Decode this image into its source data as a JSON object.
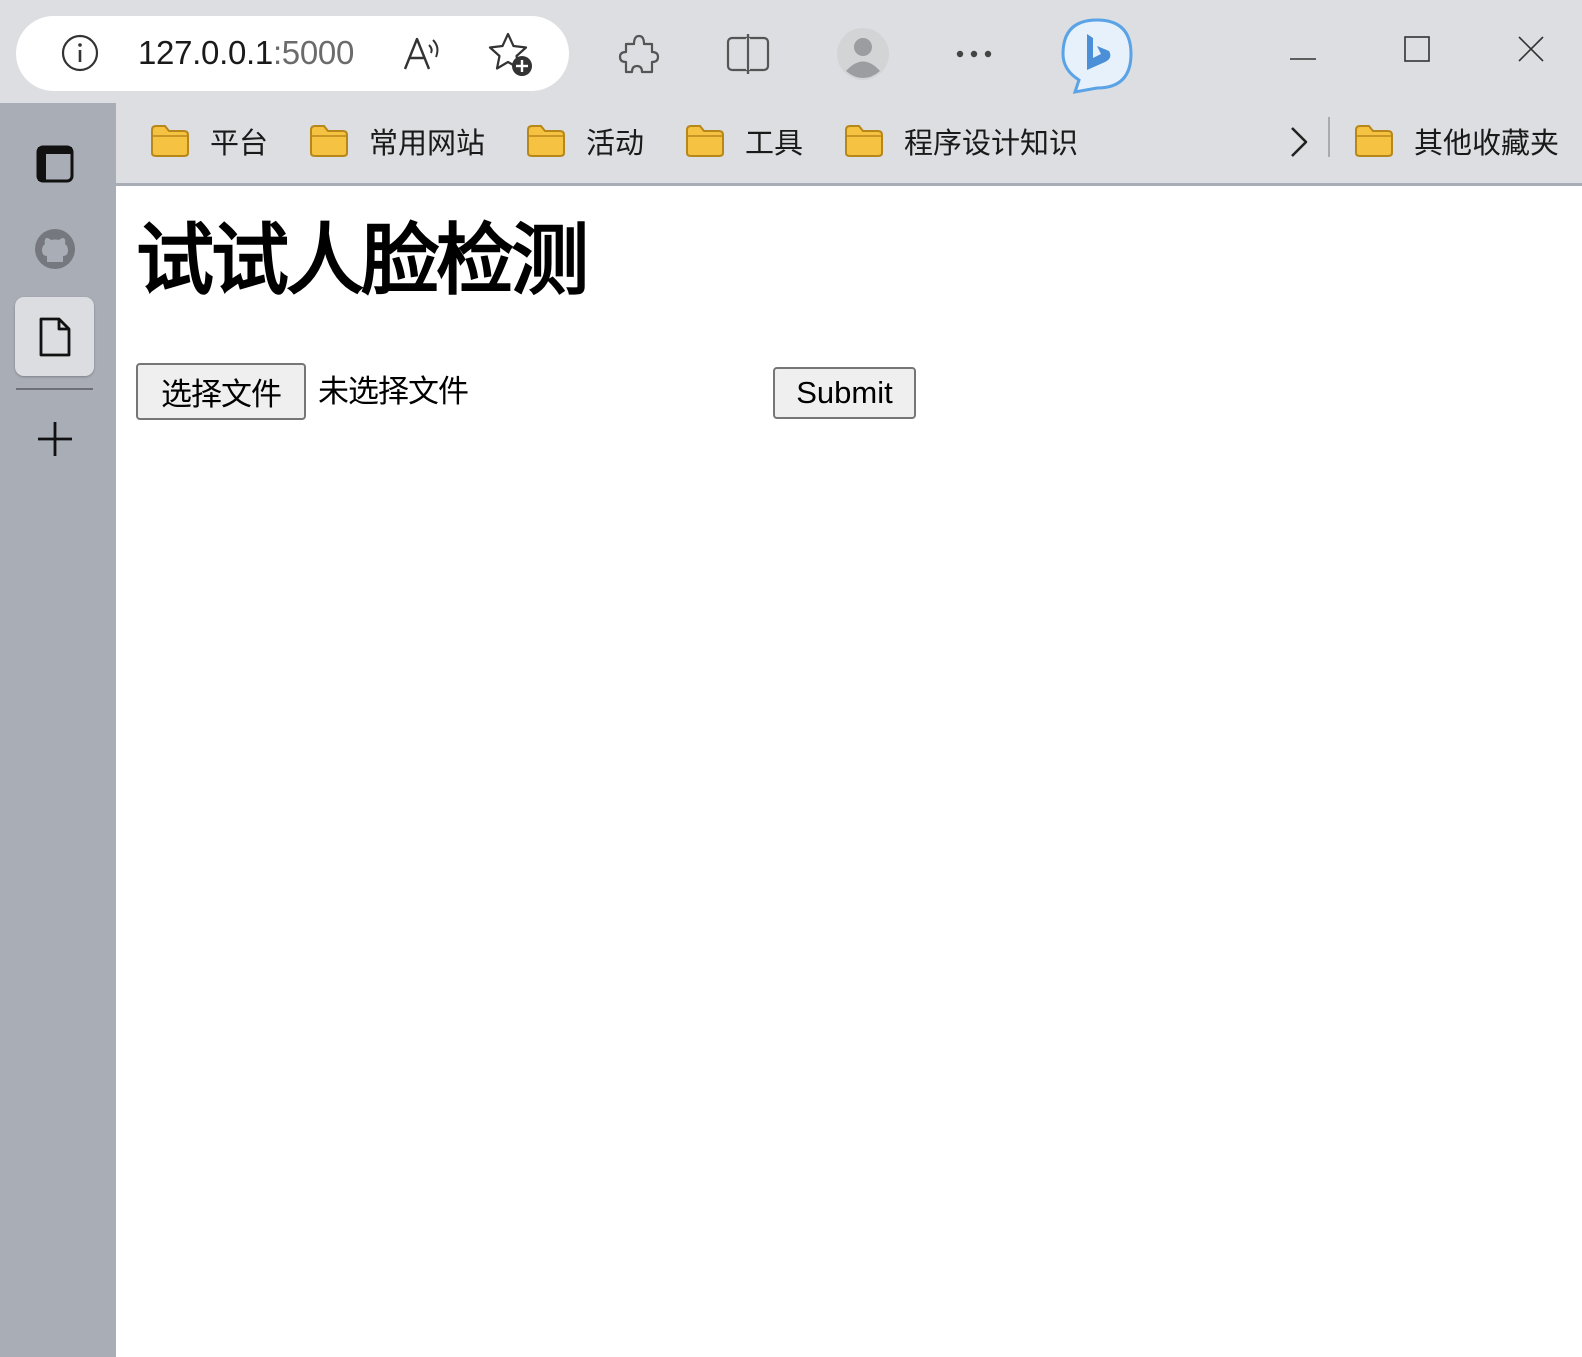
{
  "browser": {
    "address_bar": {
      "url_host": "127.0.0.1",
      "url_port": ":5000"
    },
    "icons": [
      "info-icon",
      "read-aloud-icon",
      "add-favorite-icon",
      "extensions-icon",
      "split-screen-icon",
      "profile-avatar",
      "more-icon",
      "bing-chat-icon",
      "minimize-icon",
      "maximize-icon",
      "close-icon"
    ]
  },
  "sidebar": {
    "items": [
      "tab-actions-icon",
      "github-icon",
      "document-icon",
      "add-icon"
    ]
  },
  "favorites_bar": {
    "items": [
      {
        "label": "平台"
      },
      {
        "label": "常用网站"
      },
      {
        "label": "活动"
      },
      {
        "label": "工具"
      },
      {
        "label": "程序设计知识"
      }
    ],
    "other_favorites": "其他收藏夹",
    "folder_color": "#f5c242"
  },
  "page": {
    "title": "试试人脸检测",
    "file_button_label": "选择文件",
    "file_status": "未选择文件",
    "submit_label": "Submit"
  }
}
